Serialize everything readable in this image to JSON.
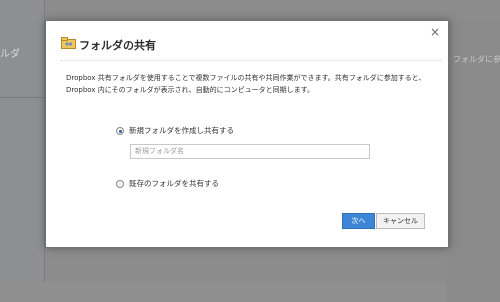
{
  "background": {
    "left_label": "ルダ",
    "right_text": "フォルダに参加"
  },
  "dialog": {
    "title": "フォルダの共有",
    "close_glyph": "×",
    "description": "Dropbox 共有フォルダを使用することで複数ファイルの共有や共同作業ができます。共有フォルダに参加すると、Dropbox 内にそのフォルダが表示され、自動的にコンピュータと同期します。",
    "options": [
      {
        "label": "新規フォルダを作成し共有する",
        "selected": true
      },
      {
        "label": "既存のフォルダを共有する",
        "selected": false
      }
    ],
    "folder_name_placeholder": "新規フォルダ名",
    "buttons": {
      "next": "次へ",
      "cancel": "キャンセル"
    },
    "colors": {
      "primary_button": "#3d86d6",
      "overlay": "#8c8c8c"
    }
  }
}
